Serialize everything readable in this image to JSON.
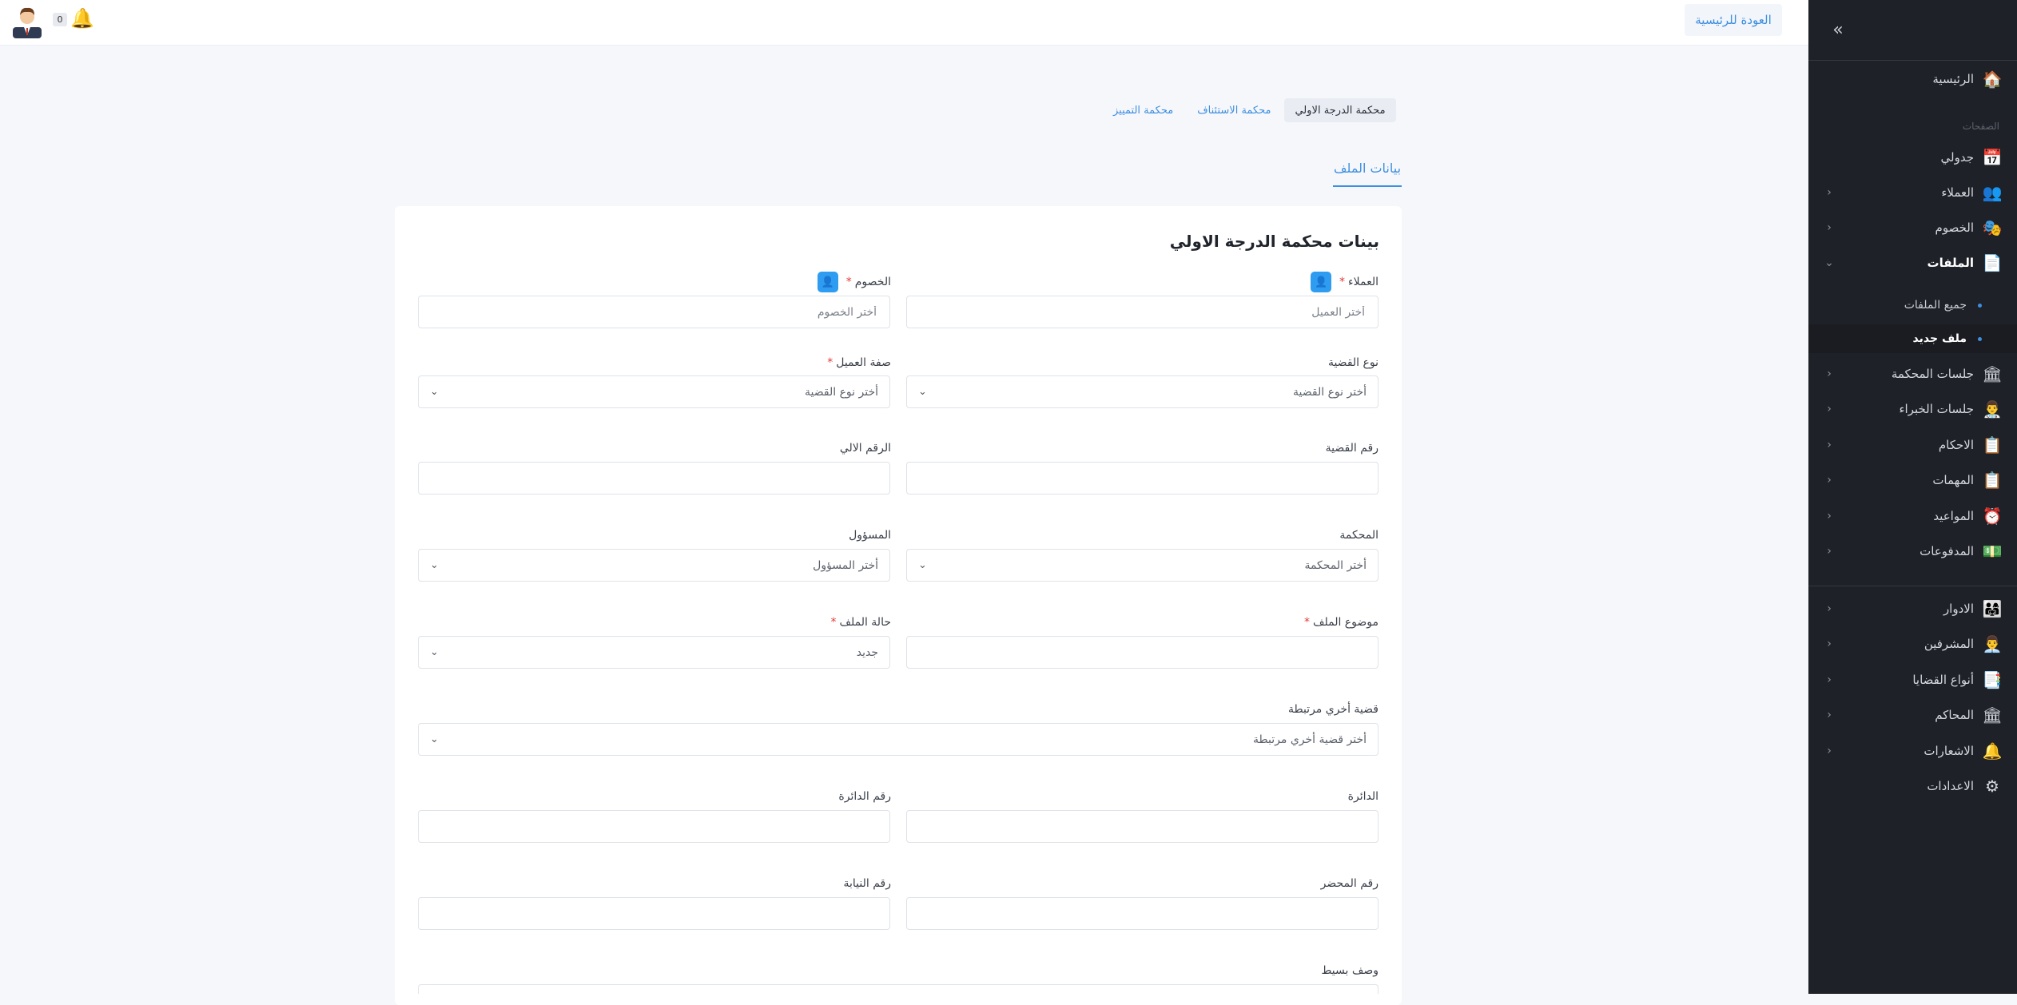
{
  "topbar": {
    "back_home": "العودة للرئيسية",
    "notif_count": "0"
  },
  "sidebar": {
    "home": "الرئيسية",
    "section_pages": "الصفحات",
    "schedule": "جدولي",
    "clients": "العملاء",
    "opponents": "الخصوم",
    "files": "الملفات",
    "files_all": "جميع الملفات",
    "files_new": "ملف جديد",
    "court_sessions": "جلسات المحكمة",
    "expert_sessions": "جلسات الخبراء",
    "rulings": "الاحكام",
    "tasks": "المهمات",
    "appointments": "المواعيد",
    "payments": "المدفوعات",
    "roles": "الادوار",
    "supervisors": "المشرفين",
    "case_types": "أنواع القضايا",
    "courts": "المحاكم",
    "notifications": "الاشعارات",
    "settings": "الاعدادات"
  },
  "court_tabs": [
    "محكمة الدرجة الاولي",
    "محكمة الاستئناف",
    "محكمة التمييز"
  ],
  "section_tab": "بيانات الملف",
  "form": {
    "title": "بينات محكمة الدرجة الاولي",
    "clients_label": "العملاء",
    "clients_placeholder": "أختر العميل",
    "opponents_label": "الخصوم",
    "opponents_placeholder": "أختر الخصوم",
    "case_type_label": "نوع القضية",
    "case_type_value": "أختر نوع القضية",
    "client_capacity_label": "صفة العميل",
    "client_capacity_value": "أختر نوع القضية",
    "case_number_label": "رقم القضية",
    "auto_number_label": "الرقم الالي",
    "court_label": "المحكمة",
    "court_value": "أختر المحكمة",
    "responsible_label": "المسؤول",
    "responsible_value": "أختر المسؤول",
    "subject_label": "موضوع الملف",
    "status_label": "حالة الملف",
    "status_value": "جديد",
    "related_case_label": "قضية أخري مرتبطة",
    "related_case_value": "أختر قضية أخري مرتبطة",
    "circuit_label": "الدائرة",
    "circuit_number_label": "رقم الدائرة",
    "report_number_label": "رقم المحضر",
    "prosecution_number_label": "رقم النيابة",
    "description_label": "وصف بسيط",
    "required_mark": "*"
  }
}
